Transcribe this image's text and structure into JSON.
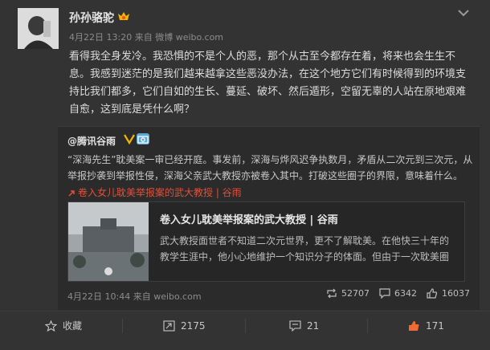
{
  "post": {
    "author": "孙孙骆驼",
    "timestamp": "4月22日 13:20",
    "source": "来自 微博 weibo.com",
    "text": "看得我全身发冷。我恐惧的不是个人的恶，那个从古至今都存在着，将来也会生生不息。我感到迷茫的是我们越来越拿这些恶没办法，在这个地方它们有时候得到的环境支持比我们都多，它们自如的生长、蔓延、破坏、然后遁形，空留无辜的人站在原地艰难自愈，这到底是凭什么啊？"
  },
  "repost": {
    "author": "@腾讯谷雨",
    "text": "“深海先生”耽美案一审已经开庭。事发前，深海与烨风迟争执数月，矛盾从二次元到三次元，从举报抄袭到举报性侵，深海父亲武大教授亦被卷入其中。打破这些圈子的界限，意味着什么。",
    "link_label": "卷入女儿耽美举报案的武大教授 | 谷雨",
    "card": {
      "title": "卷入女儿耽美举报案的武大教授 | 谷雨",
      "description": "武大教授面世者不知道二次元世界，更不了解耽美。在他快三十年的教学生涯中，他小心地维护一个知识分子的体面。但由于一次耽美圈"
    },
    "timestamp": "4月22日 10:44",
    "source": "来自 weibo.com",
    "stats": {
      "reposts": "52707",
      "comments": "6342",
      "likes": "16037"
    }
  },
  "actions": {
    "favorite": "收藏",
    "repost": "2175",
    "comment": "21",
    "like": "171"
  },
  "colors": {
    "background": "#333333",
    "link": "#e0503a",
    "like_icon": "#f06a35",
    "verified": "#f5b400"
  }
}
